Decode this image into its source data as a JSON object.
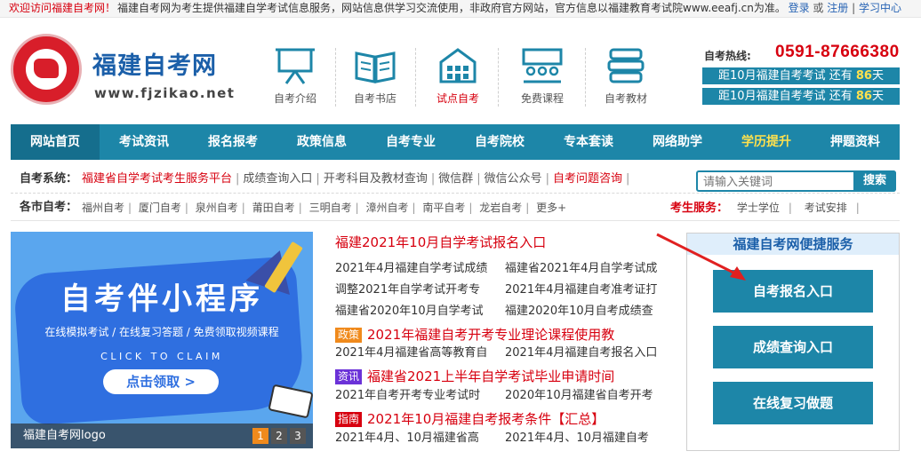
{
  "topbar": {
    "welcome": "欢迎访问福建自考网！",
    "notice": "福建自考网为考生提供福建自学考试信息服务，网站信息供学习交流使用，非政府官方网站，官方信息以福建教育考试院www.eeafj.cn为准。",
    "login": "登录",
    "or": "或",
    "register": "注册",
    "divider": "|",
    "study": "学习中心"
  },
  "header": {
    "site_title": "福建自考网",
    "site_url": "www.fjzikao.net",
    "quick_links": [
      {
        "label": "自考介绍",
        "icon": "presentation-board-icon"
      },
      {
        "label": "自考书店",
        "icon": "open-book-icon"
      },
      {
        "label": "试点自考",
        "icon": "building-icon"
      },
      {
        "label": "免费课程",
        "icon": "classroom-icon"
      },
      {
        "label": "自考教材",
        "icon": "textbook-stack-icon"
      }
    ],
    "hotline_label": "自考热线:",
    "hotline": "0591-87666380",
    "countdowns": [
      {
        "text": "距10月福建自考考试 还有",
        "days": "86",
        "unit": "天"
      },
      {
        "text": "距10月福建自考考试 还有",
        "days": "86",
        "unit": "天"
      }
    ]
  },
  "nav": [
    "网站首页",
    "考试资讯",
    "报名报考",
    "政策信息",
    "自考专业",
    "自考院校",
    "专本套读",
    "网络助学",
    "学历提升",
    "押题资料"
  ],
  "system": {
    "head": "自考系统：",
    "links": [
      "福建省自学考试考生服务平台",
      "成绩查询入口",
      "开考科目及教材查询",
      "微信群",
      "微信公众号",
      "自考问题咨询"
    ],
    "search_placeholder": "请输入关键词",
    "search_button": "搜索"
  },
  "cities": {
    "head": "各市自考：",
    "items": [
      "福州自考",
      "厦门自考",
      "泉州自考",
      "莆田自考",
      "三明自考",
      "漳州自考",
      "南平自考",
      "龙岩自考",
      "更多+"
    ],
    "service_label": "考生服务：",
    "service_items": [
      "学士学位",
      "考试安排"
    ]
  },
  "banner": {
    "title": "自考伴小程序",
    "subtitle": "在线模拟考试 / 在线复习答题 / 免费领取视频课程",
    "click": "CLICK TO CLAIM",
    "cta": "点击领取 >",
    "caption": "福建自考网logo",
    "pages": [
      "1",
      "2",
      "3"
    ]
  },
  "news": {
    "top": "福建2021年10月自学考试报名入口",
    "rows": [
      [
        "2021年4月福建自学考试成绩",
        "福建省2021年4月自学考试成"
      ],
      [
        "调整2021年自学考试开考专",
        "2021年4月福建自考准考证打"
      ],
      [
        "福建省2020年10月自学考试",
        "福建2020年10月自考成绩查"
      ],
      [
        "2021年4月福建省高等教育自",
        "2021年4月福建自考报名入口"
      ],
      [
        "2021年自考开考专业考试时",
        "2020年10月福建省自考开考"
      ],
      [
        "2021年4月、10月福建省高",
        "2021年4月、10月福建自考"
      ]
    ],
    "highlights": [
      {
        "tag": "政策",
        "text": "2021年福建自考开考专业理论课程使用教"
      },
      {
        "tag": "资讯",
        "text": "福建省2021上半年自学考试毕业申请时间"
      },
      {
        "tag": "指南",
        "text": "2021年10月福建自考报考条件【汇总】"
      }
    ]
  },
  "service": {
    "title": "福建自考网便捷服务",
    "buttons": [
      "自考报名入口",
      "成绩查询入口",
      "在线复习做题"
    ]
  },
  "colors": {
    "primary": "#1d86a8",
    "brand_blue": "#1b5fa9",
    "red": "#d7000f",
    "highlight_yellow": "#ffe14d"
  }
}
